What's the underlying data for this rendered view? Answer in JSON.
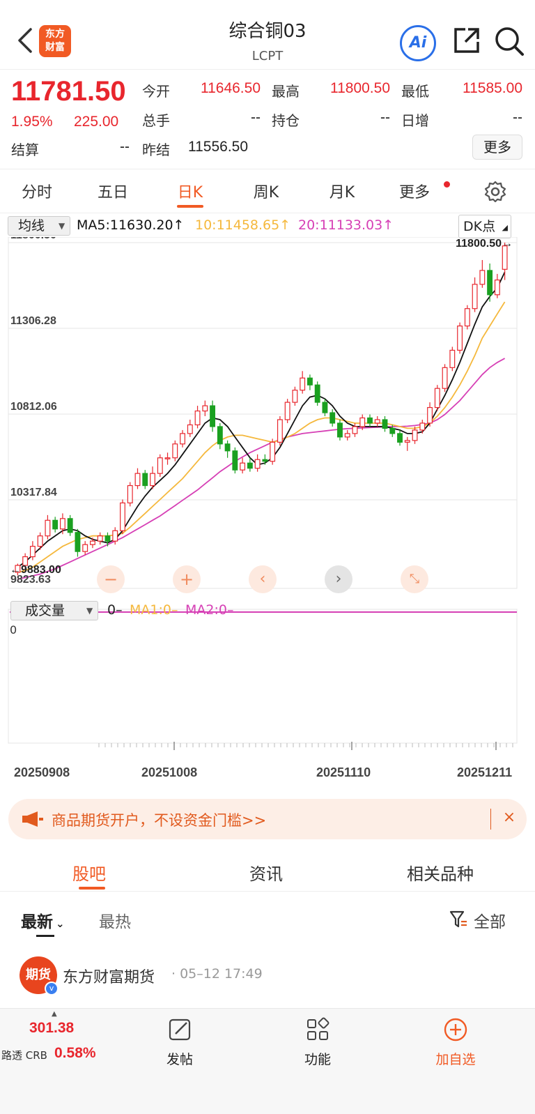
{
  "header": {
    "logo_text": "东方财富",
    "title": "综合铜03",
    "subtitle": "LCPT",
    "ai_label": "Ai"
  },
  "quote": {
    "price": "11781.50",
    "change_pct": "1.95%",
    "change": "225.00",
    "fields": {
      "open_label": "今开",
      "open": "11646.50",
      "high_label": "最高",
      "high": "11800.50",
      "low_label": "最低",
      "low": "11585.00",
      "volume_label": "总手",
      "volume": "--",
      "position_label": "持仓",
      "position": "--",
      "daily_inc_label": "日增",
      "daily_inc": "--",
      "settle_label": "结算",
      "settle": "--",
      "prev_settle_label": "昨结",
      "prev_settle": "11556.50"
    },
    "more_label": "更多"
  },
  "period_tabs": [
    "分时",
    "五日",
    "日K",
    "周K",
    "月K",
    "更多"
  ],
  "active_period": "日K",
  "indicators": {
    "select_label": "均线",
    "ma5": "MA5:11630.20↑",
    "ma10": "10:11458.65↑",
    "ma20": "20:11133.03↑",
    "dk_label": "DK点",
    "ma5_color": "#111111",
    "ma10_color": "#f5b83c",
    "ma20_color": "#d63fb5"
  },
  "chart_data": {
    "type": "candlestick",
    "y_ticks": [
      "11800.50",
      "11306.28",
      "10812.06",
      "10317.84"
    ],
    "ylim": [
      9823.63,
      11800.5
    ],
    "max_label": "11800.50→",
    "min_label": "←9883.00",
    "bottom_label": "9823.63",
    "x_labels": [
      "20250908",
      "20251008",
      "20251110",
      "20251211"
    ],
    "candles": [
      [
        9900,
        9940,
        9883,
        9950
      ],
      [
        9940,
        9990,
        9920,
        10010
      ],
      [
        9990,
        10050,
        9970,
        10080
      ],
      [
        10050,
        10110,
        10030,
        10130
      ],
      [
        10110,
        10200,
        10090,
        10230
      ],
      [
        10200,
        10150,
        10130,
        10220
      ],
      [
        10150,
        10210,
        10120,
        10240
      ],
      [
        10210,
        10130,
        10110,
        10230
      ],
      [
        10130,
        10020,
        9990,
        10150
      ],
      [
        10020,
        10060,
        10000,
        10080
      ],
      [
        10060,
        10080,
        10040,
        10100
      ],
      [
        10080,
        10110,
        10060,
        10130
      ],
      [
        10110,
        10080,
        10050,
        10130
      ],
      [
        10080,
        10140,
        10060,
        10160
      ],
      [
        10140,
        10300,
        10120,
        10320
      ],
      [
        10300,
        10400,
        10280,
        10420
      ],
      [
        10400,
        10470,
        10380,
        10500
      ],
      [
        10470,
        10400,
        10380,
        10490
      ],
      [
        10400,
        10470,
        10380,
        10510
      ],
      [
        10470,
        10560,
        10450,
        10580
      ],
      [
        10560,
        10560,
        10520,
        10590
      ],
      [
        10560,
        10640,
        10540,
        10660
      ],
      [
        10640,
        10700,
        10620,
        10720
      ],
      [
        10700,
        10750,
        10680,
        10780
      ],
      [
        10750,
        10830,
        10730,
        10860
      ],
      [
        10830,
        10860,
        10800,
        10890
      ],
      [
        10860,
        10740,
        10710,
        10890
      ],
      [
        10740,
        10640,
        10610,
        10760
      ],
      [
        10640,
        10600,
        10560,
        10660
      ],
      [
        10600,
        10490,
        10470,
        10620
      ],
      [
        10490,
        10530,
        10470,
        10560
      ],
      [
        10530,
        10500,
        10480,
        10560
      ],
      [
        10500,
        10550,
        10480,
        10580
      ],
      [
        10550,
        10540,
        10520,
        10580
      ],
      [
        10540,
        10650,
        10520,
        10670
      ],
      [
        10650,
        10780,
        10630,
        10800
      ],
      [
        10780,
        10880,
        10760,
        10900
      ],
      [
        10880,
        10950,
        10860,
        10970
      ],
      [
        10950,
        11020,
        10930,
        11060
      ],
      [
        11020,
        10980,
        10950,
        11040
      ],
      [
        10980,
        10880,
        10860,
        11000
      ],
      [
        10880,
        10820,
        10800,
        10900
      ],
      [
        10820,
        10760,
        10740,
        10840
      ],
      [
        10760,
        10680,
        10660,
        10780
      ],
      [
        10680,
        10700,
        10660,
        10720
      ],
      [
        10700,
        10740,
        10680,
        10760
      ],
      [
        10740,
        10790,
        10720,
        10810
      ],
      [
        10790,
        10760,
        10740,
        10810
      ],
      [
        10760,
        10780,
        10740,
        10800
      ],
      [
        10780,
        10730,
        10710,
        10800
      ],
      [
        10730,
        10700,
        10680,
        10750
      ],
      [
        10700,
        10650,
        10630,
        10720
      ],
      [
        10650,
        10660,
        10600,
        10680
      ],
      [
        10660,
        10720,
        10640,
        10740
      ],
      [
        10720,
        10760,
        10700,
        10780
      ],
      [
        10760,
        10850,
        10740,
        10880
      ],
      [
        10850,
        10960,
        10830,
        10980
      ],
      [
        10960,
        11080,
        10940,
        11100
      ],
      [
        11080,
        11180,
        11060,
        11200
      ],
      [
        11180,
        11320,
        11160,
        11340
      ],
      [
        11320,
        11420,
        11300,
        11440
      ],
      [
        11420,
        11560,
        11400,
        11600
      ],
      [
        11560,
        11640,
        11540,
        11700
      ],
      [
        11640,
        11500,
        11460,
        11680
      ],
      [
        11500,
        11585,
        11480,
        11620
      ],
      [
        11646.5,
        11781.5,
        11585,
        11800.5
      ]
    ],
    "ma5": [
      9930,
      9960,
      10000,
      10040,
      10080,
      10110,
      10140,
      10150,
      10140,
      10110,
      10090,
      10080,
      10070,
      10090,
      10140,
      10210,
      10280,
      10340,
      10390,
      10430,
      10470,
      10520,
      10580,
      10640,
      10700,
      10760,
      10790,
      10780,
      10740,
      10680,
      10620,
      10560,
      10520,
      10530,
      10560,
      10620,
      10700,
      10780,
      10860,
      10910,
      10920,
      10900,
      10860,
      10800,
      10760,
      10740,
      10740,
      10740,
      10740,
      10740,
      10730,
      10720,
      10700,
      10700,
      10710,
      10760,
      10840,
      10920,
      11010,
      11110,
      11220,
      11330,
      11430,
      11490,
      11540,
      11630.2
    ],
    "ma10": [
      9900,
      9910,
      9930,
      9960,
      9990,
      10020,
      10050,
      10070,
      10090,
      10100,
      10110,
      10110,
      10110,
      10115,
      10125,
      10160,
      10200,
      10240,
      10280,
      10320,
      10360,
      10400,
      10440,
      10490,
      10540,
      10590,
      10630,
      10660,
      10680,
      10690,
      10690,
      10680,
      10670,
      10660,
      10650,
      10660,
      10680,
      10700,
      10730,
      10760,
      10780,
      10790,
      10790,
      10780,
      10770,
      10760,
      10760,
      10760,
      10760,
      10760,
      10750,
      10740,
      10730,
      10730,
      10740,
      10760,
      10800,
      10850,
      10910,
      10980,
      11060,
      11150,
      11250,
      11320,
      11390,
      11458.65
    ],
    "ma20": [
      9860,
      9870,
      9880,
      9890,
      9905,
      9920,
      9940,
      9960,
      9980,
      10000,
      10020,
      10040,
      10060,
      10080,
      10100,
      10125,
      10150,
      10175,
      10200,
      10225,
      10255,
      10285,
      10315,
      10345,
      10375,
      10410,
      10445,
      10480,
      10510,
      10540,
      10565,
      10590,
      10610,
      10630,
      10650,
      10665,
      10680,
      10690,
      10700,
      10705,
      10710,
      10715,
      10720,
      10725,
      10728,
      10730,
      10732,
      10734,
      10736,
      10738,
      10740,
      10740,
      10742,
      10746,
      10752,
      10760,
      10780,
      10810,
      10850,
      10890,
      10940,
      10990,
      11040,
      11080,
      11110,
      11133.03
    ]
  },
  "volume_panel": {
    "select_label": "成交量",
    "vol_value": "0–",
    "ma1": "MA1:0–",
    "ma2": "MA2:0–",
    "axis_zero": "0"
  },
  "banner": {
    "text": "商品期货开户，不设资金门槛>>",
    "close": "×"
  },
  "content_tabs": [
    "股吧",
    "资讯",
    "相关品种"
  ],
  "active_content_tab": "股吧",
  "sort": {
    "latest": "最新",
    "hot": "最热",
    "filter": "全部"
  },
  "post": {
    "avatar_text": "期货",
    "author": "东方财富期货",
    "time": "· 05–12 17:49"
  },
  "bottom_bar": {
    "index_value": "301.38",
    "index_name": "路透 CRB",
    "index_change": "0.58%",
    "post_label": "发帖",
    "function_label": "功能",
    "watch_label": "加自选"
  },
  "colors": {
    "up": "#e8262d",
    "down": "#1aa020",
    "accent": "#f15a24"
  }
}
